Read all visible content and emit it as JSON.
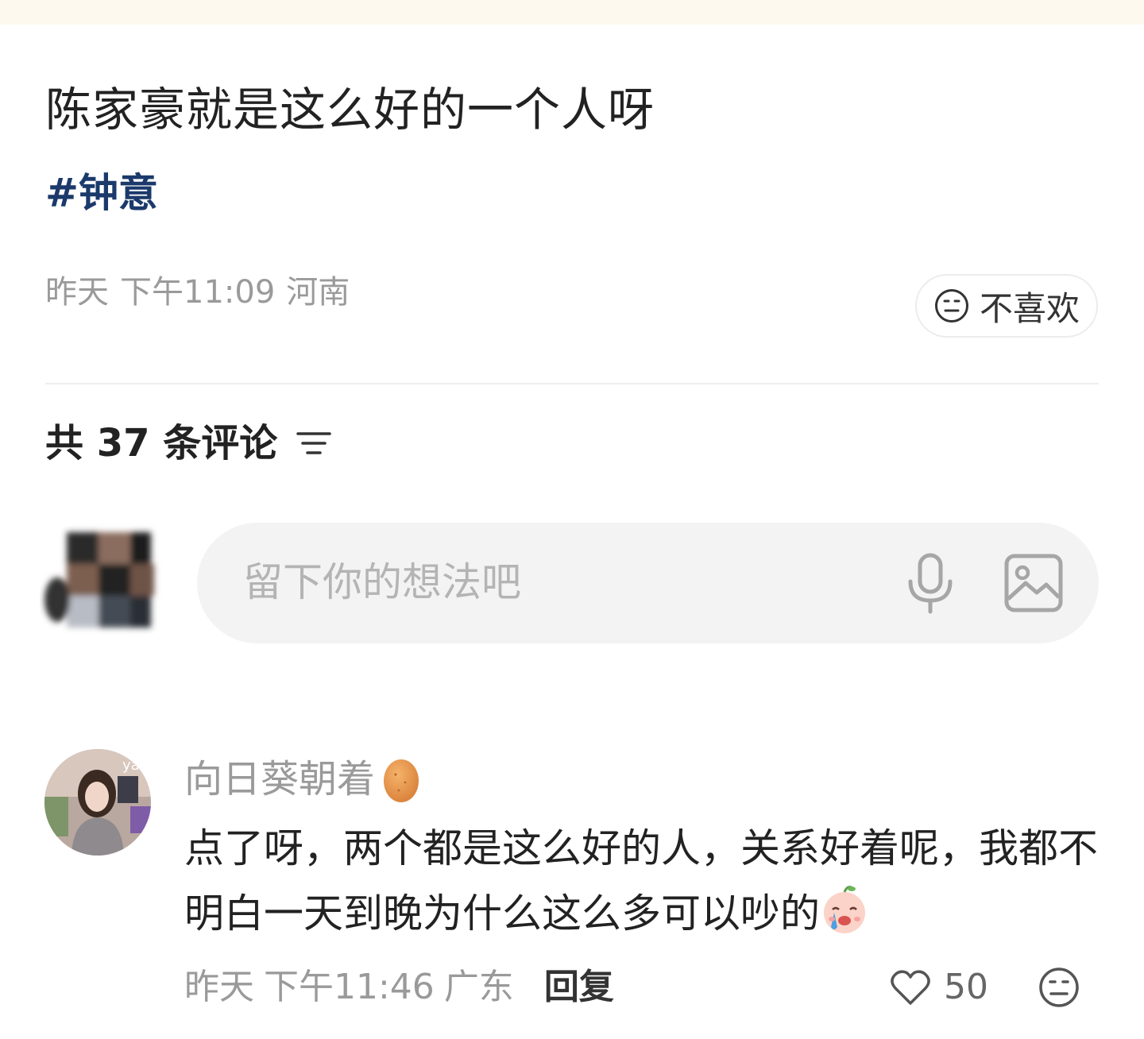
{
  "post": {
    "title": "陈家豪就是这么好的一个人呀",
    "hashtag": "#钟意",
    "date": "昨天",
    "time": "下午11:09",
    "location": "河南",
    "dislike_label": "不喜欢"
  },
  "comments_section": {
    "header": "共 37 条评论",
    "input_placeholder": "留下你的想法吧"
  },
  "comments": [
    {
      "author": "向日葵朝着",
      "text": "点了呀，两个都是这么好的人，关系好着呢，我都不明白一天到晚为什么这么多可以吵的",
      "date": "昨天",
      "time": "下午11:46",
      "location": "广东",
      "reply_label": "回复",
      "likes": "50"
    }
  ],
  "icons": {
    "dislike": "meh-face-icon",
    "sort": "sort-filter-icon",
    "mic": "microphone-icon",
    "image": "image-icon",
    "badge": "egg-icon",
    "emoji": "crying-face-icon",
    "like": "heart-icon"
  },
  "colors": {
    "hashtag": "#1b3a6b",
    "meta": "#9a9a9a",
    "input_bg": "#f3f3f3"
  }
}
